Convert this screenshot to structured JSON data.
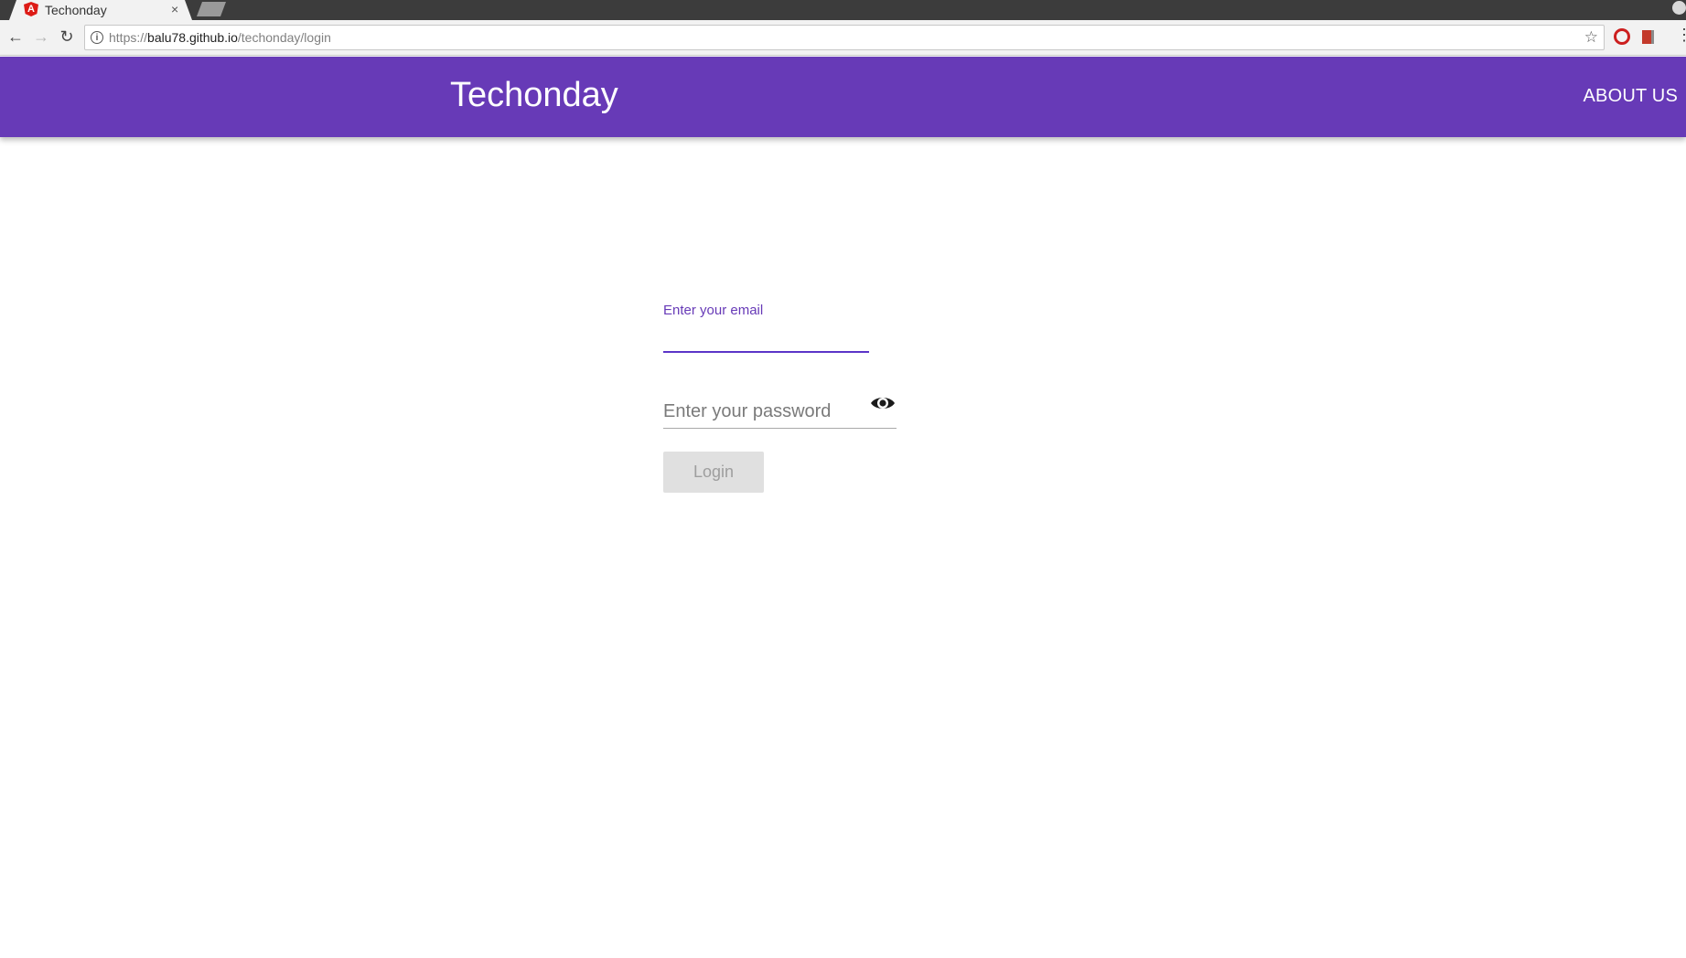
{
  "browser": {
    "tab_title": "Techonday",
    "tab_close": "×",
    "favicon_letter": "A",
    "url_scheme": "https://",
    "url_host": "balu78.github.io",
    "url_path": "/techonday/login",
    "back_icon": "←",
    "forward_icon": "→",
    "reload_icon": "↻",
    "info_icon": "i",
    "star_icon": "☆",
    "menu_icon": "⋮"
  },
  "header": {
    "brand": "Techonday",
    "about_link": "ABOUT US",
    "color": "#673ab7"
  },
  "login_form": {
    "email_label": "Enter your email",
    "email_value": "",
    "password_placeholder": "Enter your password",
    "password_value": "",
    "login_button": "Login",
    "accent_color": "#673ab7"
  }
}
